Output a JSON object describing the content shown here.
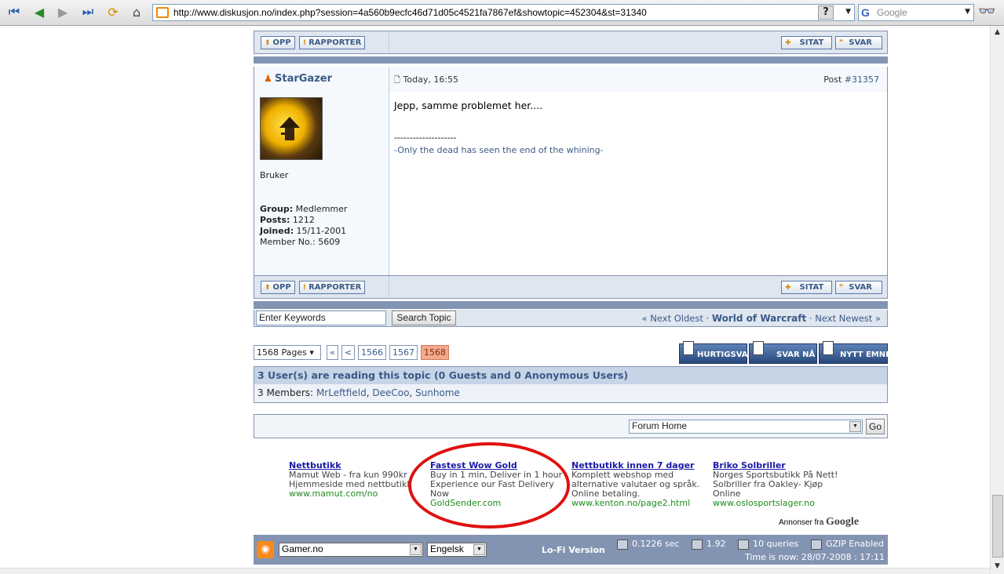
{
  "browser": {
    "url": "http://www.diskusjon.no/index.php?session=4a560b9ecfc46d71d05c4521fa7867ef&showtopic=452304&st=31340",
    "help": "?",
    "search_placeholder": "Google"
  },
  "post_actions": {
    "up": "OPP",
    "report": "RAPPORTER",
    "quote": "SITAT",
    "reply": "SVAR"
  },
  "post": {
    "author": "StarGazer",
    "time": "Today, 16:55",
    "post_label": "Post",
    "post_number": "#31357",
    "rank": "Bruker",
    "group_label": "Group:",
    "group": "Medlemmer",
    "posts_label": "Posts:",
    "posts": "1212",
    "joined_label": "Joined:",
    "joined": "15/11-2001",
    "member_no": "Member No.: 5609",
    "message": "Jepp, samme problemet her....",
    "sig_divider": "--------------------",
    "signature": "-Only the dead has seen the end of the whining-"
  },
  "topic_search": {
    "placeholder": "Enter Keywords",
    "value": "Enter Keywords",
    "button": "Search Topic"
  },
  "topic_nav": {
    "prev": "« Next Oldest",
    "sep1": "·",
    "forum": "World of Warcraft",
    "sep2": "·",
    "next": "Next Newest »"
  },
  "pagination": {
    "pages_select": "1568 Pages ▾",
    "first": "«",
    "prev": "<",
    "pages": [
      "1566",
      "1567",
      "1568"
    ],
    "current": "1568"
  },
  "actions": {
    "quick_reply": "HURTIGSVAR",
    "reply_now": "SVAR NÅ",
    "new_topic": "NYTT EMNE"
  },
  "readers": {
    "header": "3 User(s) are reading this topic (0 Guests and 0 Anonymous Users)",
    "prefix": "3 Members:",
    "members": [
      "MrLeftfield",
      "DeeCoo",
      "Sunhome"
    ]
  },
  "jump": {
    "selected": "Forum Home",
    "go": "Go"
  },
  "ads": [
    {
      "title": "Nettbutikk",
      "desc": "Mamut Web - fra kun 990kr\nHjemmeside med nettbutikk",
      "url": "www.mamut.com/no"
    },
    {
      "title": "Fastest Wow Gold",
      "desc": "Buy in 1 min, Deliver in 1 hour\nExperience our Fast Delivery\nNow",
      "url": "GoldSender.com"
    },
    {
      "title": "Nettbutikk innen 7 dager",
      "desc": "Komplett webshop med\nalternative valutaer og språk.\nOnline betaling.",
      "url": "www.kenton.no/page2.html"
    },
    {
      "title": "Briko Solbriller",
      "desc": "Norges Sportsbutikk På Nett!\nSolbriller fra Oakley- Kjøp\nOnline",
      "url": "www.oslosportslager.no"
    }
  ],
  "ads_by": {
    "prefix": "Annonser fra",
    "brand": "Google"
  },
  "footer": {
    "site_select": "Gamer.no",
    "lang_select": "Engelsk",
    "lofi": "Lo-Fi Version",
    "time_sec": "0.1226 sec",
    "load": "1.92",
    "queries": "10 queries",
    "gzip": "GZIP Enabled",
    "time_now": "Time is now: 28/07-2008 : 17:11"
  },
  "colors": {
    "accent": "#3a5a87",
    "border": "#8394b2",
    "highlight_circle": "#e01010"
  }
}
